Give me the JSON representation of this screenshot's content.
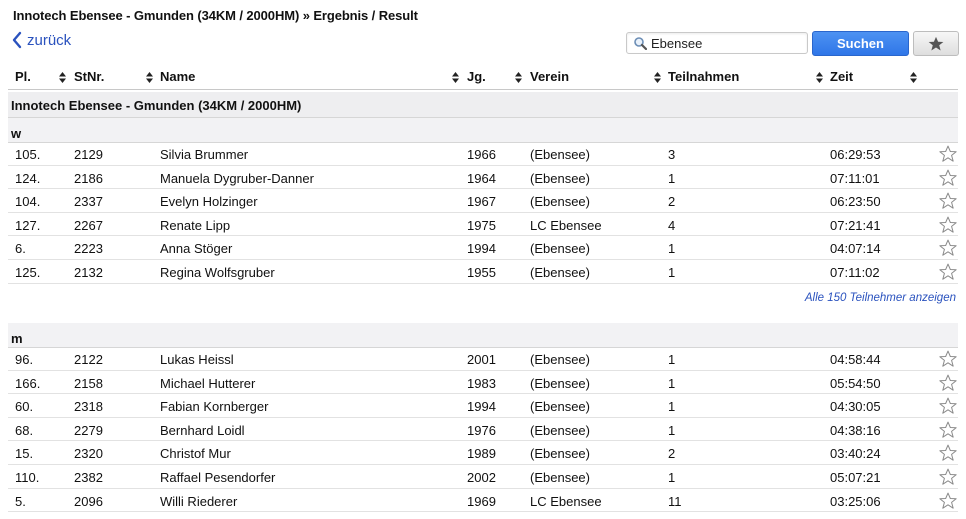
{
  "header": {
    "title": "Innotech Ebensee - Gmunden (34KM / 2000HM) » Ergebnis / Result",
    "back_label": "zurück",
    "search_value": "Ebensee",
    "search_button": "Suchen",
    "favorite_icon": "star-icon"
  },
  "columns": [
    "Pl.",
    "StNr.",
    "Name",
    "Jg.",
    "Verein",
    "Teilnahmen",
    "Zeit"
  ],
  "section_title": "Innotech Ebensee - Gmunden (34KM / 2000HM)",
  "groups": [
    {
      "label": "w",
      "rows": [
        [
          "105.",
          "2129",
          "Silvia Brummer",
          "1966",
          "(Ebensee)",
          "3",
          "06:29:53"
        ],
        [
          "124.",
          "2186",
          "Manuela Dygruber-Danner",
          "1964",
          "(Ebensee)",
          "1",
          "07:11:01"
        ],
        [
          "104.",
          "2337",
          "Evelyn Holzinger",
          "1967",
          "(Ebensee)",
          "2",
          "06:23:50"
        ],
        [
          "127.",
          "2267",
          "Renate Lipp",
          "1975",
          "LC Ebensee",
          "4",
          "07:21:41"
        ],
        [
          "6.",
          "2223",
          "Anna Stöger",
          "1994",
          "(Ebensee)",
          "1",
          "04:07:14"
        ],
        [
          "125.",
          "2132",
          "Regina Wolfsgruber",
          "1955",
          "(Ebensee)",
          "1",
          "07:11:02"
        ]
      ],
      "more_link": "Alle 150 Teilnehmer anzeigen"
    },
    {
      "label": "m",
      "rows": [
        [
          "96.",
          "2122",
          "Lukas Heissl",
          "2001",
          "(Ebensee)",
          "1",
          "04:58:44"
        ],
        [
          "166.",
          "2158",
          "Michael Hutterer",
          "1983",
          "(Ebensee)",
          "1",
          "05:54:50"
        ],
        [
          "60.",
          "2318",
          "Fabian Kornberger",
          "1994",
          "(Ebensee)",
          "1",
          "04:30:05"
        ],
        [
          "68.",
          "2279",
          "Bernhard Loidl",
          "1976",
          "(Ebensee)",
          "1",
          "04:38:16"
        ],
        [
          "15.",
          "2320",
          "Christof Mur",
          "1989",
          "(Ebensee)",
          "2",
          "03:40:24"
        ],
        [
          "110.",
          "2382",
          "Raffael Pesendorfer",
          "2002",
          "(Ebensee)",
          "1",
          "05:07:21"
        ],
        [
          "5.",
          "2096",
          "Willi Riederer",
          "1969",
          "LC Ebensee",
          "11",
          "03:25:06"
        ]
      ]
    }
  ],
  "colors": {
    "link": "#2a52be",
    "search_button": "#3a82ee",
    "section_bg": "#eeeef0"
  }
}
